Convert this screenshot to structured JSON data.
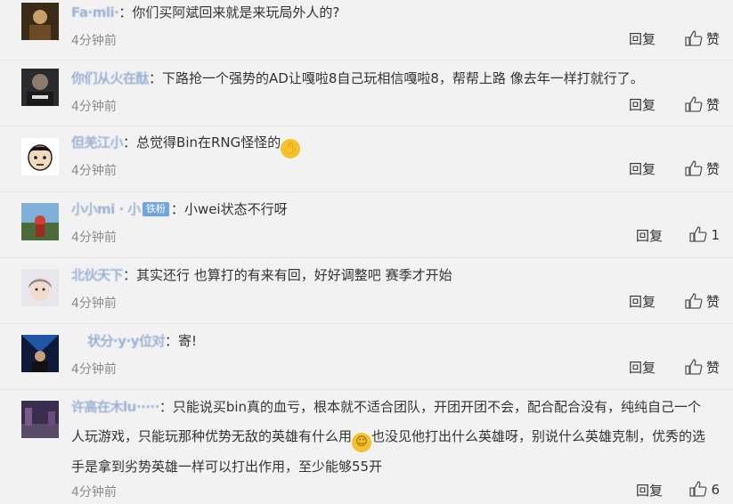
{
  "comments": [
    {
      "nick": "Fa·mli·",
      "text": "你们买阿斌回来就是来玩局外人的?",
      "time": "4分钟前",
      "reply": "回复",
      "like": "赞"
    },
    {
      "nick": "你们从火在酞",
      "text": "下路抢一个强势的AD让嘎啦8自己玩相信嘎啦8，帮帮上路 像去年一样打就行了。",
      "time": "4分钟前",
      "reply": "回复",
      "like": "赞"
    },
    {
      "nick": "但羌江小",
      "text": "总觉得Bin在RNG怪怪的",
      "time": "4分钟前",
      "reply": "回复",
      "like": "赞"
    },
    {
      "nick": "小小mi · 小",
      "badge": "铁粉",
      "text": "小wei状态不行呀",
      "time": "4分钟前",
      "reply": "回复",
      "like": "1"
    },
    {
      "nick": "北伙天下",
      "text": "其实还行 也算打的有来有回，好好调整吧 赛季才开始",
      "time": "4分钟前",
      "reply": "回复",
      "like": "赞"
    },
    {
      "nick": "状分·y·y位对",
      "text": "寄!",
      "time": "4分钟前",
      "reply": "回复",
      "like": "赞"
    },
    {
      "nick": "许高在木lu·····",
      "text_a": "只能说买bin真的血亏，根本就不适合团队，开团开团不会，配合配合没有，纯纯自己一个人玩游戏，只能玩那种优势无敌的英雄有什么用",
      "text_b": "也没见他打出什么英雄呀，别说什么英雄克制，优秀的选手是拿到劣势英雄一样可以打出作用，至少能够55开",
      "time": "4分钟前",
      "reply": "回复",
      "like": "6"
    }
  ],
  "colors": {
    "nick": "#9bb2d4",
    "badge": "#6fa5e0",
    "time": "#8c8c8c",
    "emoji": "#f4c22b"
  }
}
